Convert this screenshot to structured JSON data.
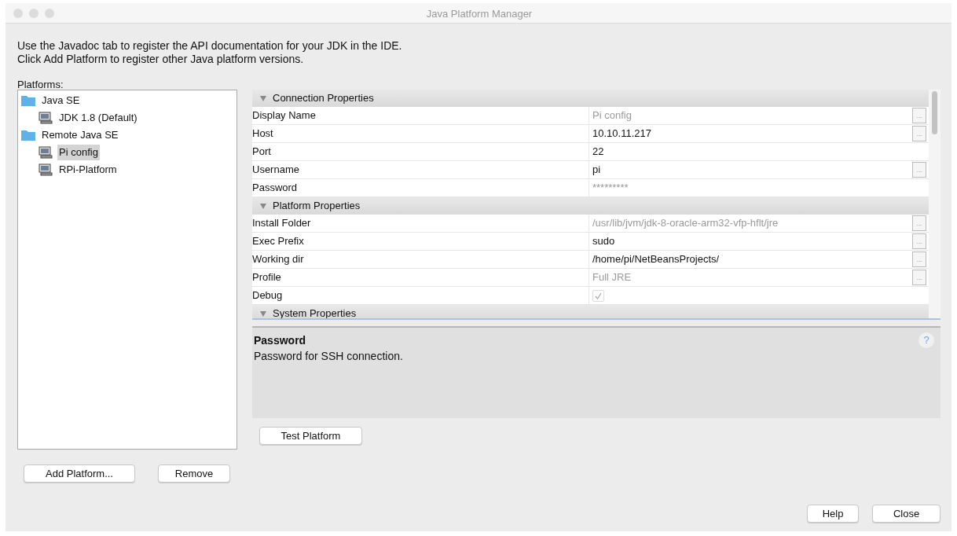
{
  "window": {
    "title": "Java Platform Manager"
  },
  "intro": [
    "Use the Javadoc tab to register the API documentation for your JDK in the IDE.",
    "Click Add Platform to register other Java platform versions."
  ],
  "platforms_label": "Platforms:",
  "platforms": [
    {
      "label": "Java SE",
      "kind": "folder",
      "selected": false,
      "children": [
        {
          "label": "JDK 1.8 (Default)",
          "kind": "platform",
          "selected": false
        }
      ]
    },
    {
      "label": "Remote Java SE",
      "kind": "folder",
      "selected": false,
      "children": [
        {
          "label": "Pi config",
          "kind": "platform",
          "selected": true
        },
        {
          "label": "RPi-Platform",
          "kind": "platform",
          "selected": false
        }
      ]
    }
  ],
  "properties": [
    {
      "title": "Connection Properties",
      "expanded": true,
      "rows": [
        {
          "label": "Display Name",
          "kind": "text",
          "value": "Pi config",
          "muted": true,
          "has_button": true
        },
        {
          "label": "Host",
          "kind": "text",
          "value": "10.10.11.217",
          "muted": false,
          "has_button": true
        },
        {
          "label": "Port",
          "kind": "text",
          "value": "22",
          "muted": false,
          "has_button": false
        },
        {
          "label": "Username",
          "kind": "text",
          "value": "pi",
          "muted": false,
          "has_button": true
        },
        {
          "label": "Password",
          "kind": "text",
          "value": "*********",
          "muted": true,
          "has_button": false
        }
      ]
    },
    {
      "title": "Platform Properties",
      "expanded": true,
      "rows": [
        {
          "label": "Install Folder",
          "kind": "text",
          "value": "/usr/lib/jvm/jdk-8-oracle-arm32-vfp-hflt/jre",
          "muted": true,
          "has_button": true
        },
        {
          "label": "Exec Prefix",
          "kind": "text",
          "value": "sudo",
          "muted": false,
          "has_button": true
        },
        {
          "label": "Working dir",
          "kind": "text",
          "value": "/home/pi/NetBeansProjects/",
          "muted": false,
          "has_button": true
        },
        {
          "label": "Profile",
          "kind": "text",
          "value": "Full JRE",
          "muted": true,
          "has_button": true
        },
        {
          "label": "Debug",
          "kind": "checkbox",
          "checked": true,
          "muted": true,
          "has_button": false
        }
      ]
    },
    {
      "title": "System Properties",
      "expanded": true
    }
  ],
  "button_label": "...",
  "description": {
    "title": "Password",
    "text": "Password for SSH connection.",
    "help": "?"
  },
  "buttons": {
    "test": "Test Platform",
    "add": "Add Platform...",
    "remove": "Remove",
    "help": "Help",
    "close": "Close"
  }
}
